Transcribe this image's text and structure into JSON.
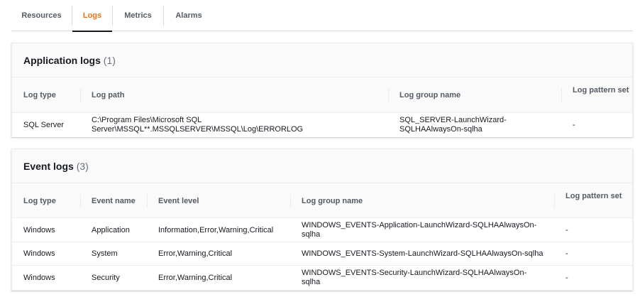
{
  "tabs": [
    "Resources",
    "Logs",
    "Metrics",
    "Alarms"
  ],
  "active_tab": "Logs",
  "application_logs": {
    "title": "Application logs",
    "count": "(1)",
    "columns": [
      "Log type",
      "Log path",
      "Log group name",
      "Log pattern set"
    ],
    "rows": [
      {
        "log_type": "SQL Server",
        "log_path_line1": "C:\\Program Files\\Microsoft SQL",
        "log_path_line2": "Server\\MSSQL**.MSSQLSERVER\\MSSQL\\Log\\ERRORLOG",
        "group_line1": "SQL_SERVER-LaunchWizard-",
        "group_line2": "SQLHAAlwaysOn-sqlha",
        "pattern": "-"
      }
    ]
  },
  "event_logs": {
    "title": "Event logs",
    "count": "(3)",
    "columns": [
      "Log type",
      "Event name",
      "Event level",
      "Log group name",
      "Log pattern set"
    ],
    "rows": [
      {
        "log_type": "Windows",
        "event_name": "Application",
        "event_level": "Information,Error,Warning,Critical",
        "group_line1": "WINDOWS_EVENTS-Application-LaunchWizard-SQLHAAlwaysOn-",
        "group_line2": "sqlha",
        "pattern": "-"
      },
      {
        "log_type": "Windows",
        "event_name": "System",
        "event_level": "Error,Warning,Critical",
        "group_line1": "WINDOWS_EVENTS-System-LaunchWizard-SQLHAAlwaysOn-sqlha",
        "group_line2": "",
        "pattern": "-"
      },
      {
        "log_type": "Windows",
        "event_name": "Security",
        "event_level": "Error,Warning,Critical",
        "group_line1": "WINDOWS_EVENTS-Security-LaunchWizard-SQLHAAlwaysOn-",
        "group_line2": "sqlha",
        "pattern": "-"
      }
    ]
  },
  "colors": {
    "accent": "#ec7211",
    "text": "#16191f",
    "muted": "#545b64"
  }
}
